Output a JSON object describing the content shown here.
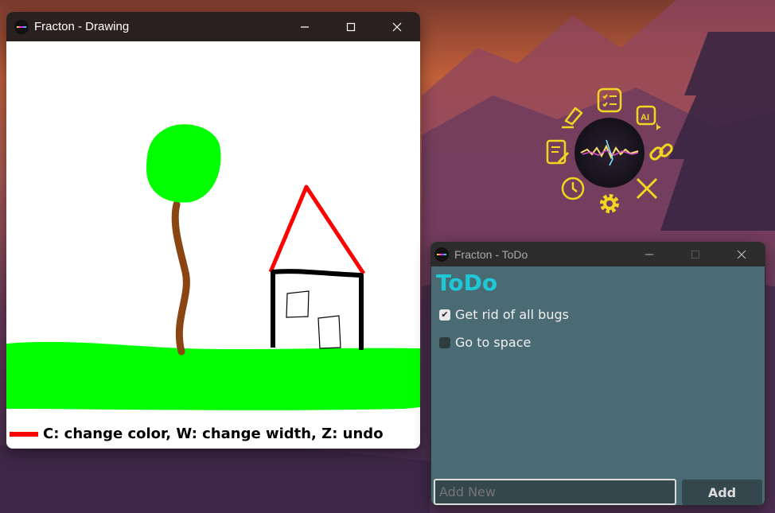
{
  "drawing_window": {
    "title": "Fracton - Drawing",
    "help_text": "C: change color, W: change width, Z: undo",
    "current_color": "#ff0000"
  },
  "todo_window": {
    "title": "Fracton - ToDo",
    "heading": "ToDo",
    "items": [
      {
        "label": "Get rid of all bugs",
        "checked": true
      },
      {
        "label": "Go to space",
        "checked": false
      }
    ],
    "input_placeholder": "Add New",
    "add_label": "Add"
  },
  "radial_menu": {
    "icons": [
      "highlighter-icon",
      "checklist-icon",
      "ai-icon",
      "notes-icon",
      "link-icon",
      "clock-icon",
      "settings-icon",
      "close-icon"
    ],
    "accent": "#f2d520"
  }
}
